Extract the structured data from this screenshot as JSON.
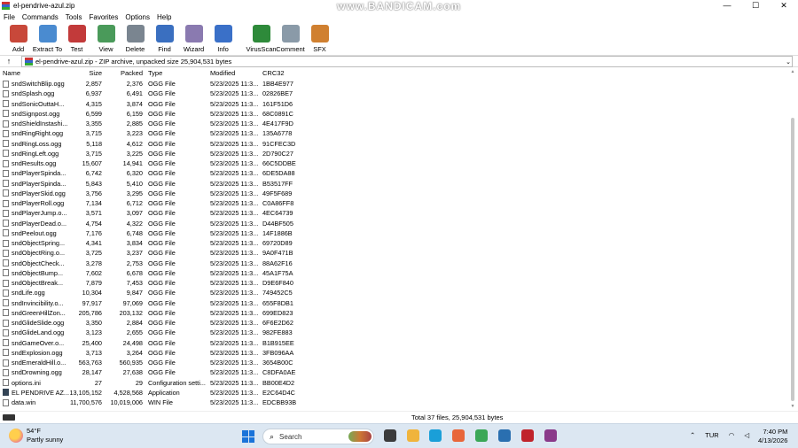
{
  "window": {
    "title": "el-pendrive-azul.zip",
    "watermark": "www.BANDICAM.com",
    "controls": [
      "—",
      "☐",
      "✕"
    ]
  },
  "menu": [
    "File",
    "Commands",
    "Tools",
    "Favorites",
    "Options",
    "Help"
  ],
  "toolbar": [
    {
      "label": "Add",
      "icon": "add-archive-icon",
      "color": "#c8483a"
    },
    {
      "label": "Extract To",
      "icon": "folder-extract-icon",
      "color": "#4a8bd0"
    },
    {
      "label": "Test",
      "icon": "test-checklist-icon",
      "color": "#c23a3a"
    },
    {
      "label": "View",
      "icon": "book-view-icon",
      "color": "#4a9a5a"
    },
    {
      "label": "Delete",
      "icon": "trash-icon",
      "color": "#7a8590"
    },
    {
      "label": "Find",
      "icon": "magnifier-icon",
      "color": "#3a6fc0"
    },
    {
      "label": "Wizard",
      "icon": "wand-icon",
      "color": "#8a7ab0"
    },
    {
      "label": "Info",
      "icon": "info-icon",
      "color": "#3a70c8"
    },
    {
      "label": "VirusScan",
      "icon": "virus-scan-icon",
      "color": "#2e8a3a"
    },
    {
      "label": "Comment",
      "icon": "comment-icon",
      "color": "#8a9aa8"
    },
    {
      "label": "SFX",
      "icon": "sfx-icon",
      "color": "#d08030"
    }
  ],
  "address": {
    "path": "el-pendrive-azul.zip - ZIP archive, unpacked size 25,904,531 bytes"
  },
  "columns": {
    "name": "Name",
    "size": "Size",
    "packed": "Packed",
    "type": "Type",
    "modified": "Modified",
    "crc": "CRC32"
  },
  "files": [
    {
      "name": "sndSwitchBlip.ogg",
      "size": "2,857",
      "packed": "2,376",
      "type": "OGG File",
      "modified": "5/23/2025 11:3...",
      "crc": "1BB4E977",
      "icon": "file"
    },
    {
      "name": "sndSplash.ogg",
      "size": "6,937",
      "packed": "6,491",
      "type": "OGG File",
      "modified": "5/23/2025 11:3...",
      "crc": "02826BE7",
      "icon": "file"
    },
    {
      "name": "sndSonicOuttaH...",
      "size": "4,315",
      "packed": "3,874",
      "type": "OGG File",
      "modified": "5/23/2025 11:3...",
      "crc": "161F51D6",
      "icon": "file"
    },
    {
      "name": "sndSignpost.ogg",
      "size": "6,599",
      "packed": "6,159",
      "type": "OGG File",
      "modified": "5/23/2025 11:3...",
      "crc": "68C0891C",
      "icon": "file"
    },
    {
      "name": "sndShieldInstashi...",
      "size": "3,355",
      "packed": "2,885",
      "type": "OGG File",
      "modified": "5/23/2025 11:3...",
      "crc": "4E417F9D",
      "icon": "file"
    },
    {
      "name": "sndRingRight.ogg",
      "size": "3,715",
      "packed": "3,223",
      "type": "OGG File",
      "modified": "5/23/2025 11:3...",
      "crc": "135A6778",
      "icon": "file"
    },
    {
      "name": "sndRingLoss.ogg",
      "size": "5,118",
      "packed": "4,612",
      "type": "OGG File",
      "modified": "5/23/2025 11:3...",
      "crc": "91CFEC3D",
      "icon": "file"
    },
    {
      "name": "sndRingLeft.ogg",
      "size": "3,715",
      "packed": "3,225",
      "type": "OGG File",
      "modified": "5/23/2025 11:3...",
      "crc": "2D790C27",
      "icon": "file"
    },
    {
      "name": "sndResults.ogg",
      "size": "15,607",
      "packed": "14,941",
      "type": "OGG File",
      "modified": "5/23/2025 11:3...",
      "crc": "66C5DDBE",
      "icon": "file"
    },
    {
      "name": "sndPlayerSpinda...",
      "size": "6,742",
      "packed": "6,320",
      "type": "OGG File",
      "modified": "5/23/2025 11:3...",
      "crc": "6DE5DA88",
      "icon": "file"
    },
    {
      "name": "sndPlayerSpinda...",
      "size": "5,843",
      "packed": "5,410",
      "type": "OGG File",
      "modified": "5/23/2025 11:3...",
      "crc": "B53517FF",
      "icon": "file"
    },
    {
      "name": "sndPlayerSkid.ogg",
      "size": "3,756",
      "packed": "3,295",
      "type": "OGG File",
      "modified": "5/23/2025 11:3...",
      "crc": "49F5F689",
      "icon": "file"
    },
    {
      "name": "sndPlayerRoll.ogg",
      "size": "7,134",
      "packed": "6,712",
      "type": "OGG File",
      "modified": "5/23/2025 11:3...",
      "crc": "C0A86FF8",
      "icon": "file"
    },
    {
      "name": "sndPlayerJump.o...",
      "size": "3,571",
      "packed": "3,097",
      "type": "OGG File",
      "modified": "5/23/2025 11:3...",
      "crc": "4EC64739",
      "icon": "file"
    },
    {
      "name": "sndPlayerDead.o...",
      "size": "4,754",
      "packed": "4,322",
      "type": "OGG File",
      "modified": "5/23/2025 11:3...",
      "crc": "D44BF505",
      "icon": "file"
    },
    {
      "name": "sndPeelout.ogg",
      "size": "7,176",
      "packed": "6,748",
      "type": "OGG File",
      "modified": "5/23/2025 11:3...",
      "crc": "14F1886B",
      "icon": "file"
    },
    {
      "name": "sndObjectSpring...",
      "size": "4,341",
      "packed": "3,834",
      "type": "OGG File",
      "modified": "5/23/2025 11:3...",
      "crc": "69720D89",
      "icon": "file"
    },
    {
      "name": "sndObjectRing.o...",
      "size": "3,725",
      "packed": "3,237",
      "type": "OGG File",
      "modified": "5/23/2025 11:3...",
      "crc": "9A0F471B",
      "icon": "file"
    },
    {
      "name": "sndObjectCheck...",
      "size": "3,278",
      "packed": "2,753",
      "type": "OGG File",
      "modified": "5/23/2025 11:3...",
      "crc": "88A62F16",
      "icon": "file"
    },
    {
      "name": "sndObjectBump...",
      "size": "7,602",
      "packed": "6,678",
      "type": "OGG File",
      "modified": "5/23/2025 11:3...",
      "crc": "45A1F75A",
      "icon": "file"
    },
    {
      "name": "sndObjectBreak...",
      "size": "7,879",
      "packed": "7,453",
      "type": "OGG File",
      "modified": "5/23/2025 11:3...",
      "crc": "D9E6F840",
      "icon": "file"
    },
    {
      "name": "sndLife.ogg",
      "size": "10,304",
      "packed": "9,847",
      "type": "OGG File",
      "modified": "5/23/2025 11:3...",
      "crc": "749452C5",
      "icon": "file"
    },
    {
      "name": "sndInvincibility.o...",
      "size": "97,917",
      "packed": "97,069",
      "type": "OGG File",
      "modified": "5/23/2025 11:3...",
      "crc": "655F8DB1",
      "icon": "file"
    },
    {
      "name": "sndGreenHillZon...",
      "size": "205,786",
      "packed": "203,132",
      "type": "OGG File",
      "modified": "5/23/2025 11:3...",
      "crc": "699ED823",
      "icon": "file"
    },
    {
      "name": "sndGlideSlide.ogg",
      "size": "3,350",
      "packed": "2,884",
      "type": "OGG File",
      "modified": "5/23/2025 11:3...",
      "crc": "6F6E2D62",
      "icon": "file"
    },
    {
      "name": "sndGlideLand.ogg",
      "size": "3,123",
      "packed": "2,655",
      "type": "OGG File",
      "modified": "5/23/2025 11:3...",
      "crc": "982FE883",
      "icon": "file"
    },
    {
      "name": "sndGameOver.o...",
      "size": "25,400",
      "packed": "24,498",
      "type": "OGG File",
      "modified": "5/23/2025 11:3...",
      "crc": "B1B915EE",
      "icon": "file"
    },
    {
      "name": "sndExplosion.ogg",
      "size": "3,713",
      "packed": "3,264",
      "type": "OGG File",
      "modified": "5/23/2025 11:3...",
      "crc": "3FB096AA",
      "icon": "file"
    },
    {
      "name": "sndEmeraldHill.o...",
      "size": "563,763",
      "packed": "560,935",
      "type": "OGG File",
      "modified": "5/23/2025 11:3...",
      "crc": "3654B00C",
      "icon": "file"
    },
    {
      "name": "sndDrowning.ogg",
      "size": "28,147",
      "packed": "27,638",
      "type": "OGG File",
      "modified": "5/23/2025 11:3...",
      "crc": "C8DFA0AE",
      "icon": "file"
    },
    {
      "name": "options.ini",
      "size": "27",
      "packed": "29",
      "type": "Configuration setti...",
      "modified": "5/23/2025 11:3...",
      "crc": "BB00E4D2",
      "icon": "file"
    },
    {
      "name": "EL PENDRIVE AZ...",
      "size": "13,105,152",
      "packed": "4,528,568",
      "type": "Application",
      "modified": "5/23/2025 11:3...",
      "crc": "E2C64D4C",
      "icon": "app"
    },
    {
      "name": "data.win",
      "size": "11,700,576",
      "packed": "10,019,006",
      "type": "WIN File",
      "modified": "5/23/2025 11:3...",
      "crc": "EDCBB93B",
      "icon": "file"
    }
  ],
  "status": {
    "total": "Total 37 files, 25,904,531 bytes"
  },
  "taskbar": {
    "weather_temp": "54°F",
    "weather_desc": "Partly sunny",
    "search_label": "Search",
    "tray_lang": "TUR",
    "time": "7:40 PM",
    "date": "4/13/2026",
    "apps": [
      {
        "name": "file-manager-icon",
        "color": "#3b3b3b"
      },
      {
        "name": "folder-icon",
        "color": "#f0b43c"
      },
      {
        "name": "edge-icon",
        "color": "#1a9fd8"
      },
      {
        "name": "firefox-icon",
        "color": "#e8663a"
      },
      {
        "name": "chrome-icon",
        "color": "#3aa757"
      },
      {
        "name": "app-window-icon",
        "color": "#2a6fb0"
      },
      {
        "name": "record-icon",
        "color": "#c0232b"
      },
      {
        "name": "winrar-taskbar-icon",
        "color": "#8a3a8a"
      }
    ]
  }
}
